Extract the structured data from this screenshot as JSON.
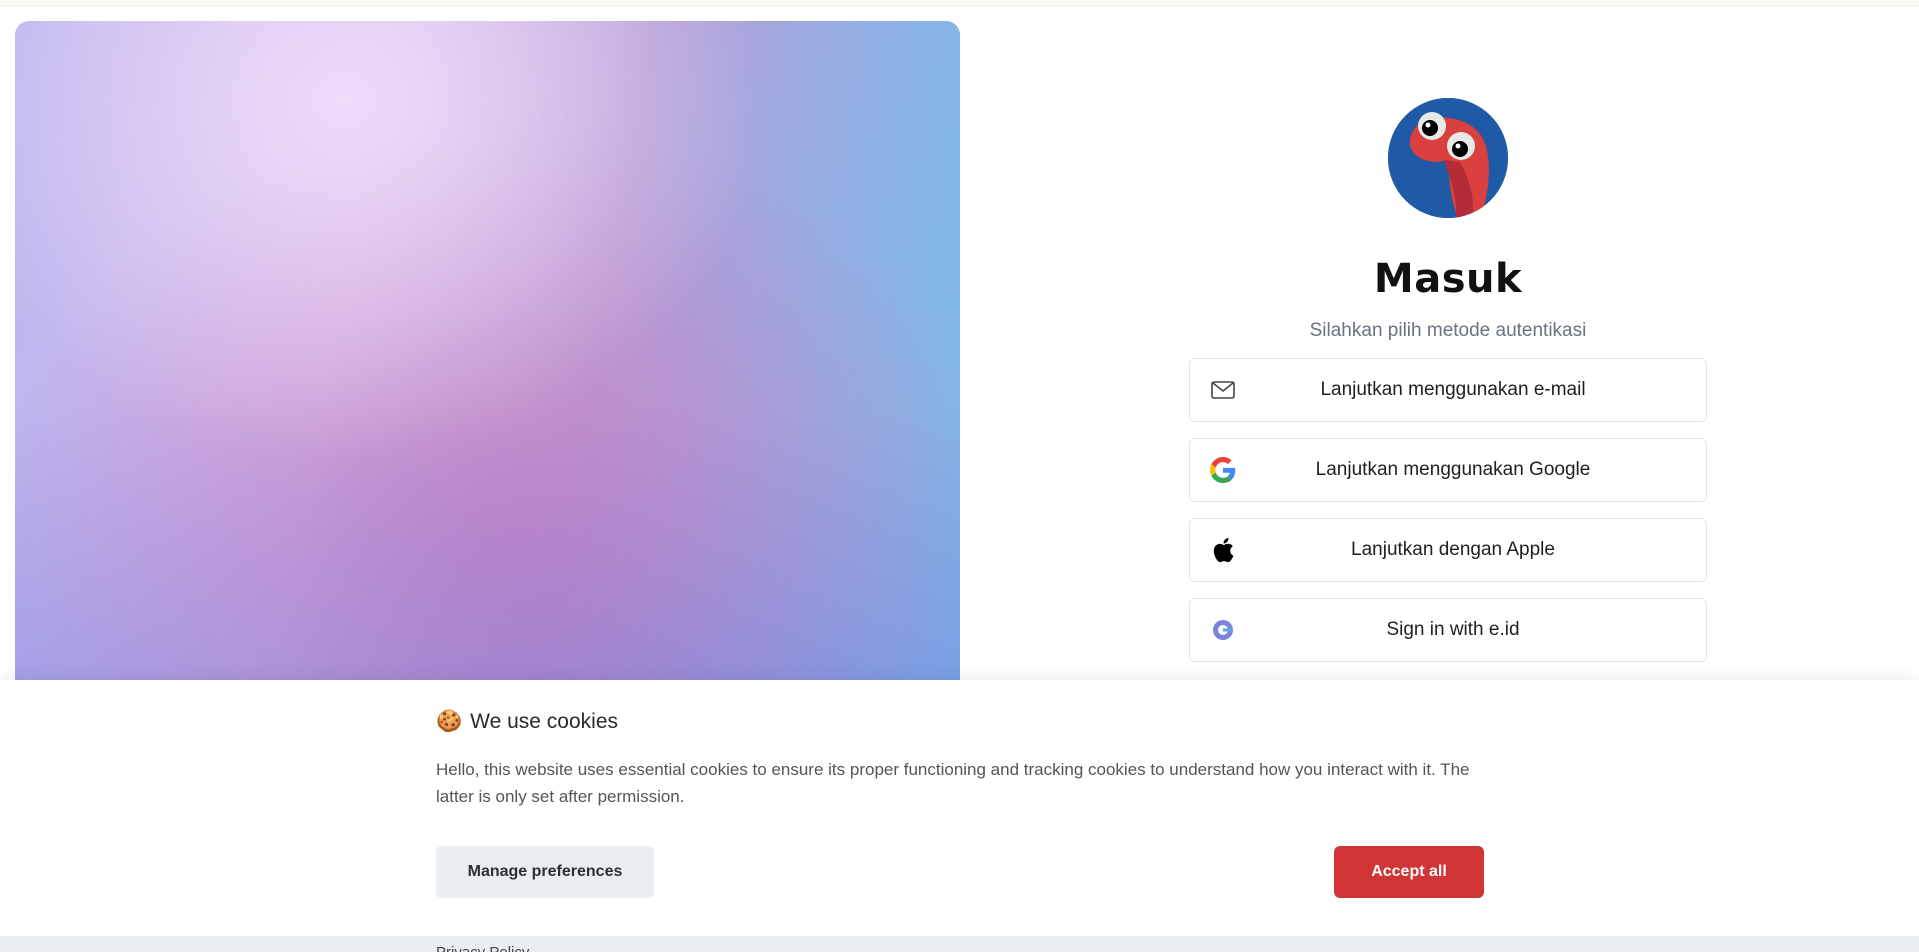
{
  "login": {
    "title": "Masuk",
    "subtitle": "Silahkan pilih metode autentikasi",
    "buttons": [
      {
        "label": "Lanjutkan menggunakan e-mail",
        "icon": "mail-icon"
      },
      {
        "label": "Lanjutkan menggunakan Google",
        "icon": "google-icon"
      },
      {
        "label": "Lanjutkan dengan Apple",
        "icon": "apple-icon"
      },
      {
        "label": "Sign in with e.id",
        "icon": "eid-icon"
      }
    ]
  },
  "cookies": {
    "emoji": "🍪",
    "title": "We use cookies",
    "text": "Hello, this website uses essential cookies to ensure its proper functioning and tracking cookies to understand how you interact with it. The latter is only set after permission.",
    "manage_label": "Manage preferences",
    "accept_label": "Accept all"
  },
  "footer": {
    "partial_text": "Privacy Policy"
  },
  "colors": {
    "accent": "#d03434",
    "avatar_bg": "#1f5aa6",
    "mascot": "#d9403f"
  }
}
